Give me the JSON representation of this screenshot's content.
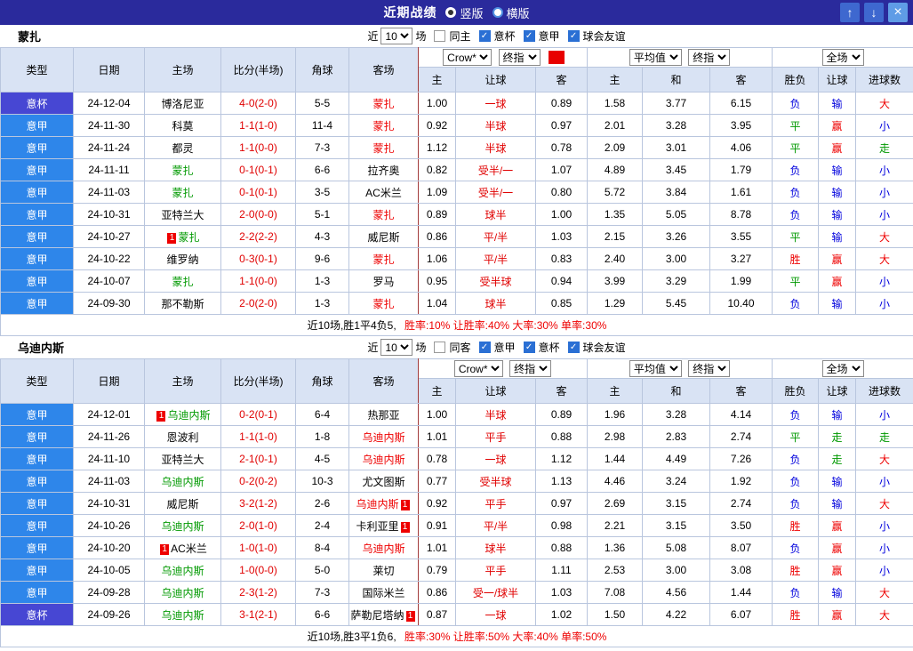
{
  "icons": {
    "check": "✓",
    "up_arrow": "↑",
    "down_arrow": "↓",
    "close": "×",
    "red_card": "1"
  },
  "colors": {
    "titlebar": "#2a2a9c",
    "table_header": "#d9e3f4",
    "league_badge": "#2e86ea",
    "cup_badge": "#4747d3",
    "win_red": "#ee0000",
    "draw_green": "#009900",
    "loss_blue": "#0000dd",
    "focal_home": "#009900",
    "focal_away": "#ee0000"
  },
  "titlebar": {
    "title": "近期战绩",
    "vertical": "竖版",
    "horizontal": "横版"
  },
  "header": {
    "main": [
      "类型",
      "日期",
      "主场",
      "比分(半场)",
      "角球",
      "客场"
    ],
    "sub": [
      "主",
      "让球",
      "客",
      "主",
      "和",
      "客",
      "胜负",
      "让球",
      "进球数"
    ],
    "dropdowns": {
      "bookmaker": "Crow*",
      "final": "终指",
      "average": "平均值",
      "final2": "终指",
      "scope": "全场"
    }
  },
  "sections": [
    {
      "team": "蒙扎",
      "red_indicator": true,
      "filter": {
        "near": "近",
        "count": "10",
        "games": "场",
        "same": "同主",
        "same_checked": false,
        "comps": [
          {
            "label": "意杯",
            "checked": true
          },
          {
            "label": "意甲",
            "checked": true
          },
          {
            "label": "球会友谊",
            "checked": true
          }
        ]
      },
      "rows": [
        {
          "type": "意杯",
          "date": "24-12-04",
          "home": {
            "name": "博洛尼亚"
          },
          "score": "4-0(2-0)",
          "corners": "5-5",
          "away": {
            "name": "蒙扎",
            "focal": true
          },
          "ah": [
            "1.00",
            "一球",
            "0.89"
          ],
          "eu": [
            "1.58",
            "3.77",
            "6.15"
          ],
          "res": [
            "负",
            "输",
            "大"
          ]
        },
        {
          "type": "意甲",
          "date": "24-11-30",
          "home": {
            "name": "科莫"
          },
          "score": "1-1(1-0)",
          "corners": "11-4",
          "away": {
            "name": "蒙扎",
            "focal": true
          },
          "ah": [
            "0.92",
            "半球",
            "0.97"
          ],
          "eu": [
            "2.01",
            "3.28",
            "3.95"
          ],
          "res": [
            "平",
            "赢",
            "小"
          ]
        },
        {
          "type": "意甲",
          "date": "24-11-24",
          "home": {
            "name": "都灵"
          },
          "score": "1-1(0-0)",
          "corners": "7-3",
          "away": {
            "name": "蒙扎",
            "focal": true
          },
          "ah": [
            "1.12",
            "半球",
            "0.78"
          ],
          "eu": [
            "2.09",
            "3.01",
            "4.06"
          ],
          "res": [
            "平",
            "赢",
            "走"
          ]
        },
        {
          "type": "意甲",
          "date": "24-11-11",
          "home": {
            "name": "蒙扎",
            "focal": true
          },
          "score": "0-1(0-1)",
          "corners": "6-6",
          "away": {
            "name": "拉齐奥"
          },
          "ah": [
            "0.82",
            "受半/一",
            "1.07"
          ],
          "eu": [
            "4.89",
            "3.45",
            "1.79"
          ],
          "res": [
            "负",
            "输",
            "小"
          ]
        },
        {
          "type": "意甲",
          "date": "24-11-03",
          "home": {
            "name": "蒙扎",
            "focal": true
          },
          "score": "0-1(0-1)",
          "corners": "3-5",
          "away": {
            "name": "AC米兰"
          },
          "ah": [
            "1.09",
            "受半/一",
            "0.80"
          ],
          "eu": [
            "5.72",
            "3.84",
            "1.61"
          ],
          "res": [
            "负",
            "输",
            "小"
          ]
        },
        {
          "type": "意甲",
          "date": "24-10-31",
          "home": {
            "name": "亚特兰大"
          },
          "score": "2-0(0-0)",
          "corners": "5-1",
          "away": {
            "name": "蒙扎",
            "focal": true
          },
          "ah": [
            "0.89",
            "球半",
            "1.00"
          ],
          "eu": [
            "1.35",
            "5.05",
            "8.78"
          ],
          "res": [
            "负",
            "输",
            "小"
          ]
        },
        {
          "type": "意甲",
          "date": "24-10-27",
          "home": {
            "name": "蒙扎",
            "focal": true,
            "badge": "pre"
          },
          "score": "2-2(2-2)",
          "corners": "4-3",
          "away": {
            "name": "威尼斯"
          },
          "ah": [
            "0.86",
            "平/半",
            "1.03"
          ],
          "eu": [
            "2.15",
            "3.26",
            "3.55"
          ],
          "res": [
            "平",
            "输",
            "大"
          ]
        },
        {
          "type": "意甲",
          "date": "24-10-22",
          "home": {
            "name": "维罗纳"
          },
          "score": "0-3(0-1)",
          "corners": "9-6",
          "away": {
            "name": "蒙扎",
            "focal": true
          },
          "ah": [
            "1.06",
            "平/半",
            "0.83"
          ],
          "eu": [
            "2.40",
            "3.00",
            "3.27"
          ],
          "res": [
            "胜",
            "赢",
            "大"
          ]
        },
        {
          "type": "意甲",
          "date": "24-10-07",
          "home": {
            "name": "蒙扎",
            "focal": true
          },
          "score": "1-1(0-0)",
          "corners": "1-3",
          "away": {
            "name": "罗马"
          },
          "ah": [
            "0.95",
            "受半球",
            "0.94"
          ],
          "eu": [
            "3.99",
            "3.29",
            "1.99"
          ],
          "res": [
            "平",
            "赢",
            "小"
          ]
        },
        {
          "type": "意甲",
          "date": "24-09-30",
          "home": {
            "name": "那不勒斯"
          },
          "score": "2-0(2-0)",
          "corners": "1-3",
          "away": {
            "name": "蒙扎",
            "focal": true
          },
          "ah": [
            "1.04",
            "球半",
            "0.85"
          ],
          "eu": [
            "1.29",
            "5.45",
            "10.40"
          ],
          "res": [
            "负",
            "输",
            "小"
          ]
        }
      ],
      "summary": {
        "record": "近10场,胜1平4负5,",
        "stats": "胜率:10% 让胜率:40% 大率:30% 单率:30%"
      }
    },
    {
      "team": "乌迪内斯",
      "red_indicator": false,
      "filter": {
        "near": "近",
        "count": "10",
        "games": "场",
        "same": "同客",
        "same_checked": false,
        "comps": [
          {
            "label": "意甲",
            "checked": true
          },
          {
            "label": "意杯",
            "checked": true
          },
          {
            "label": "球会友谊",
            "checked": true
          }
        ]
      },
      "rows": [
        {
          "type": "意甲",
          "date": "24-12-01",
          "home": {
            "name": "乌迪内斯",
            "focal": true,
            "badge": "pre"
          },
          "score": "0-2(0-1)",
          "corners": "6-4",
          "away": {
            "name": "热那亚"
          },
          "ah": [
            "1.00",
            "半球",
            "0.89"
          ],
          "eu": [
            "1.96",
            "3.28",
            "4.14"
          ],
          "res": [
            "负",
            "输",
            "小"
          ]
        },
        {
          "type": "意甲",
          "date": "24-11-26",
          "home": {
            "name": "恩波利"
          },
          "score": "1-1(1-0)",
          "corners": "1-8",
          "away": {
            "name": "乌迪内斯",
            "focal": true
          },
          "ah": [
            "1.01",
            "平手",
            "0.88"
          ],
          "eu": [
            "2.98",
            "2.83",
            "2.74"
          ],
          "res": [
            "平",
            "走",
            "走"
          ]
        },
        {
          "type": "意甲",
          "date": "24-11-10",
          "home": {
            "name": "亚特兰大"
          },
          "score": "2-1(0-1)",
          "corners": "4-5",
          "away": {
            "name": "乌迪内斯",
            "focal": true
          },
          "ah": [
            "0.78",
            "一球",
            "1.12"
          ],
          "eu": [
            "1.44",
            "4.49",
            "7.26"
          ],
          "res": [
            "负",
            "走",
            "大"
          ]
        },
        {
          "type": "意甲",
          "date": "24-11-03",
          "home": {
            "name": "乌迪内斯",
            "focal": true
          },
          "score": "0-2(0-2)",
          "corners": "10-3",
          "away": {
            "name": "尤文图斯"
          },
          "ah": [
            "0.77",
            "受半球",
            "1.13"
          ],
          "eu": [
            "4.46",
            "3.24",
            "1.92"
          ],
          "res": [
            "负",
            "输",
            "小"
          ]
        },
        {
          "type": "意甲",
          "date": "24-10-31",
          "home": {
            "name": "威尼斯"
          },
          "score": "3-2(1-2)",
          "corners": "2-6",
          "away": {
            "name": "乌迪内斯",
            "focal": true,
            "badge": "post"
          },
          "ah": [
            "0.92",
            "平手",
            "0.97"
          ],
          "eu": [
            "2.69",
            "3.15",
            "2.74"
          ],
          "res": [
            "负",
            "输",
            "大"
          ]
        },
        {
          "type": "意甲",
          "date": "24-10-26",
          "home": {
            "name": "乌迪内斯",
            "focal": true
          },
          "score": "2-0(1-0)",
          "corners": "2-4",
          "away": {
            "name": "卡利亚里",
            "badge": "post"
          },
          "ah": [
            "0.91",
            "平/半",
            "0.98"
          ],
          "eu": [
            "2.21",
            "3.15",
            "3.50"
          ],
          "res": [
            "胜",
            "赢",
            "小"
          ]
        },
        {
          "type": "意甲",
          "date": "24-10-20",
          "home": {
            "name": "AC米兰",
            "badge": "pre"
          },
          "score": "1-0(1-0)",
          "corners": "8-4",
          "away": {
            "name": "乌迪内斯",
            "focal": true
          },
          "ah": [
            "1.01",
            "球半",
            "0.88"
          ],
          "eu": [
            "1.36",
            "5.08",
            "8.07"
          ],
          "res": [
            "负",
            "赢",
            "小"
          ]
        },
        {
          "type": "意甲",
          "date": "24-10-05",
          "home": {
            "name": "乌迪内斯",
            "focal": true
          },
          "score": "1-0(0-0)",
          "corners": "5-0",
          "away": {
            "name": "莱切"
          },
          "ah": [
            "0.79",
            "平手",
            "1.11"
          ],
          "eu": [
            "2.53",
            "3.00",
            "3.08"
          ],
          "res": [
            "胜",
            "赢",
            "小"
          ]
        },
        {
          "type": "意甲",
          "date": "24-09-28",
          "home": {
            "name": "乌迪内斯",
            "focal": true
          },
          "score": "2-3(1-2)",
          "corners": "7-3",
          "away": {
            "name": "国际米兰"
          },
          "ah": [
            "0.86",
            "受一/球半",
            "1.03"
          ],
          "eu": [
            "7.08",
            "4.56",
            "1.44"
          ],
          "res": [
            "负",
            "输",
            "大"
          ]
        },
        {
          "type": "意杯",
          "date": "24-09-26",
          "home": {
            "name": "乌迪内斯",
            "focal": true
          },
          "score": "3-1(2-1)",
          "corners": "6-6",
          "away": {
            "name": "萨勒尼塔纳",
            "badge": "post"
          },
          "ah": [
            "0.87",
            "一球",
            "1.02"
          ],
          "eu": [
            "1.50",
            "4.22",
            "6.07"
          ],
          "res": [
            "胜",
            "赢",
            "大"
          ]
        }
      ],
      "summary": {
        "record": "近10场,胜3平1负6,",
        "stats": "胜率:30% 让胜率:50% 大率:40% 单率:50%"
      }
    }
  ]
}
